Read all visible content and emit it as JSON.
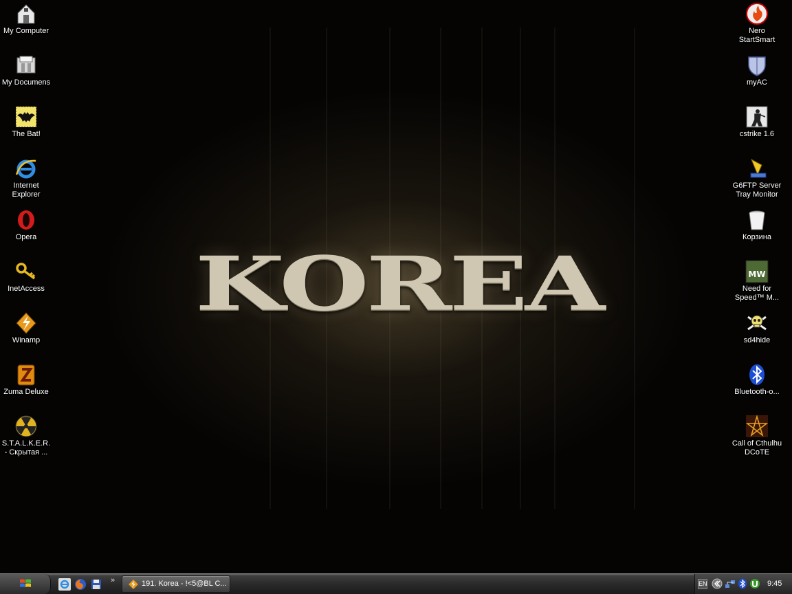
{
  "wallpaper": {
    "text": "KOREA"
  },
  "desktop_left": [
    {
      "label": "My Computer",
      "icon": "my-computer-icon"
    },
    {
      "label": "My Documens",
      "icon": "my-documents-icon"
    },
    {
      "label": "The Bat!",
      "icon": "bat-icon"
    },
    {
      "label": "Internet\nExplorer",
      "icon": "internet-explorer-icon"
    },
    {
      "label": "Opera",
      "icon": "opera-icon"
    },
    {
      "label": "InetAccess",
      "icon": "key-icon"
    },
    {
      "label": "Winamp",
      "icon": "winamp-icon"
    },
    {
      "label": "Zuma Deluxe",
      "icon": "zuma-icon"
    },
    {
      "label": "S.T.A.L.K.E.R.\n- Скрытая ...",
      "icon": "radiation-icon"
    }
  ],
  "desktop_right": [
    {
      "label": "Nero\nStartSmart",
      "icon": "nero-icon"
    },
    {
      "label": "myAC",
      "icon": "shield-icon"
    },
    {
      "label": "cstrike 1.6",
      "icon": "counter-strike-icon"
    },
    {
      "label": "G6FTP Server\nTray Monitor",
      "icon": "ftp-monitor-icon"
    },
    {
      "label": "Корзина",
      "icon": "recycle-bin-icon"
    },
    {
      "label": "Need for\nSpeed™ M...",
      "icon": "nfs-mw-icon"
    },
    {
      "label": "sd4hide",
      "icon": "skull-icon"
    },
    {
      "label": "Bluetooth-o...",
      "icon": "bluetooth-icon"
    },
    {
      "label": "Call of Cthulhu\nDCoTE",
      "icon": "pentagram-icon"
    }
  ],
  "taskbar": {
    "quick_launch": [
      "internet-explorer-icon",
      "firefox-icon",
      "save-icon"
    ],
    "more": "»",
    "task_label": "191. Korea - !<5@BL C...",
    "tray_lang": "EN",
    "clock": "9:45"
  },
  "colors": {
    "desktop_bg": "#050403",
    "wallpaper_text": "#cfc7b2",
    "taskbar": "#2a2a2a",
    "label_text": "#ffffff"
  }
}
